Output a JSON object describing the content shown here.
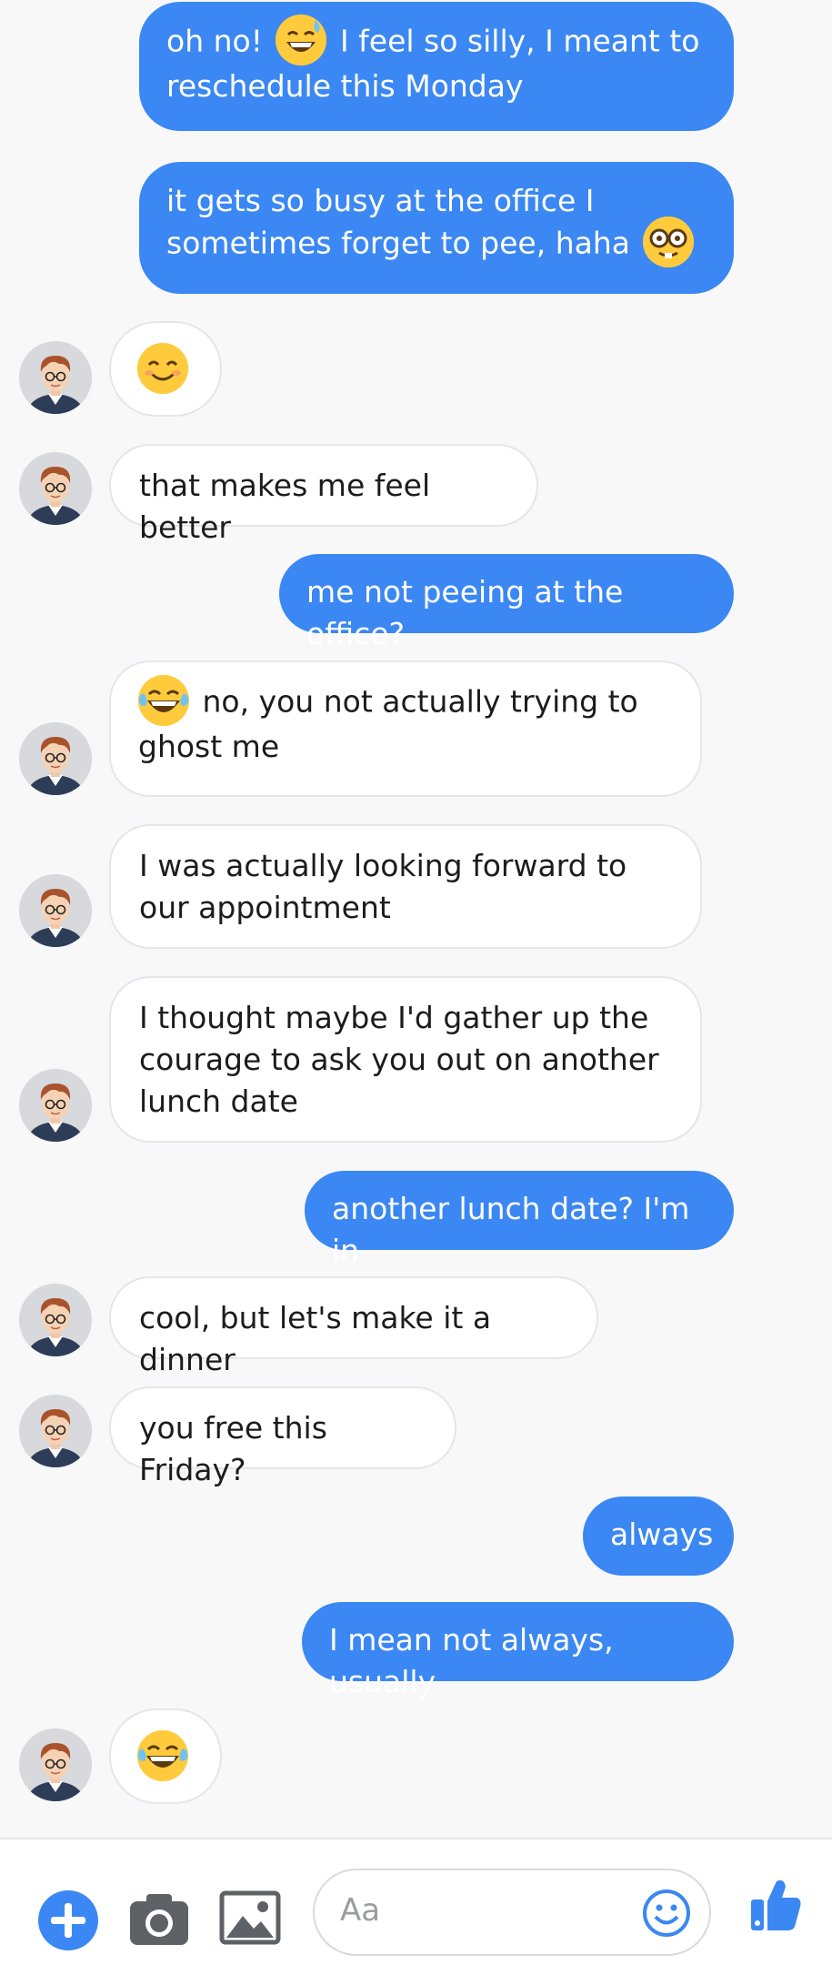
{
  "messages": [
    {
      "from": "me",
      "text_before": "oh no!",
      "emoji": "sweat-smile-emoji",
      "text_after": "I feel so silly, I meant to reschedule this Monday"
    },
    {
      "from": "me",
      "text": "it gets so busy at the office I sometimes forget to pee, haha",
      "emoji": "nerd-face-emoji"
    },
    {
      "from": "them",
      "emoji": "smiling-face-emoji"
    },
    {
      "from": "them",
      "text": "that makes me feel better"
    },
    {
      "from": "me",
      "text": "me not peeing at the office?"
    },
    {
      "from": "them",
      "emoji": "tears-of-joy-emoji",
      "text": "no, you not actually trying to ghost me"
    },
    {
      "from": "them",
      "text": "I was actually looking forward to our appointment"
    },
    {
      "from": "them",
      "text": "I thought maybe I'd gather up the courage to ask you out on another lunch date"
    },
    {
      "from": "me",
      "text": "another lunch date? I'm in"
    },
    {
      "from": "them",
      "text": "cool, but let's make it a dinner"
    },
    {
      "from": "them",
      "text": "you free this Friday?"
    },
    {
      "from": "me",
      "text": "always"
    },
    {
      "from": "me",
      "text": "I mean not always, usually"
    },
    {
      "from": "them",
      "emoji": "tears-of-joy-emoji"
    }
  ],
  "composer": {
    "placeholder": "Aa",
    "icons": [
      "plus-icon",
      "camera-icon",
      "image-icon",
      "emoji-icon",
      "thumbs-up-icon"
    ]
  },
  "colors": {
    "outgoing_bubble": "#3b87f3",
    "incoming_bubble": "#ffffff",
    "accent": "#3b87f3",
    "background": "#f8f8f9"
  }
}
